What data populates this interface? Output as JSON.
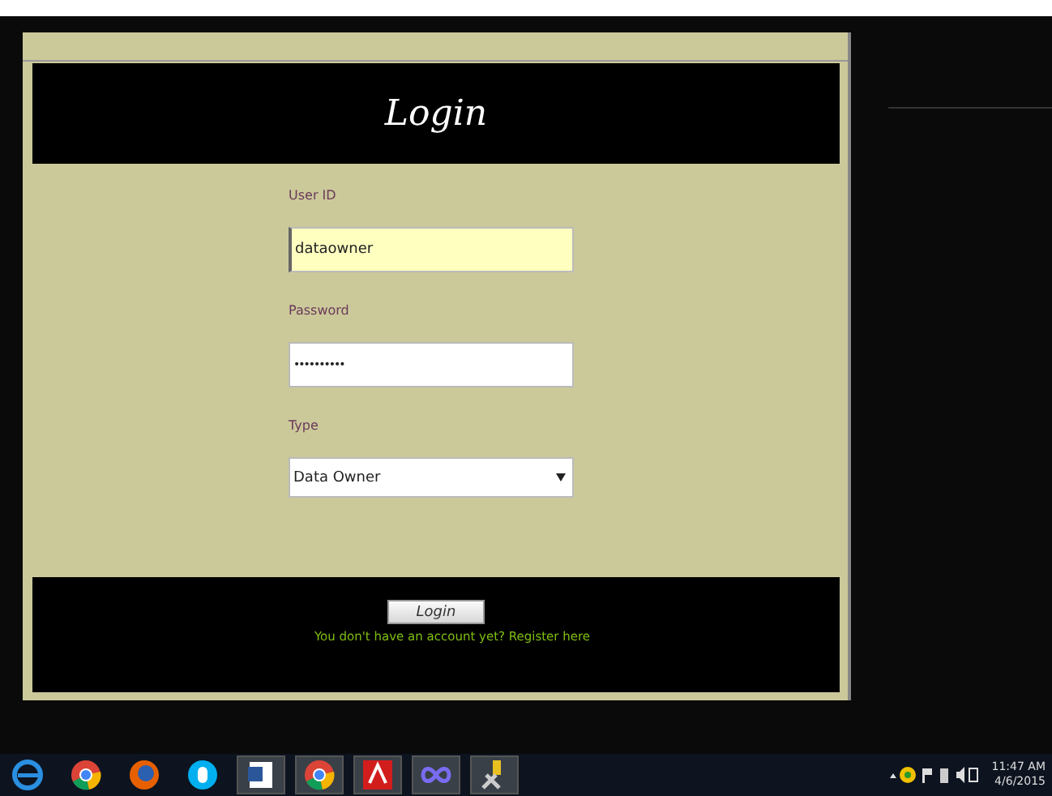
{
  "header": {
    "title": "Login"
  },
  "fields": [
    {
      "kind": "text",
      "label": "User ID",
      "value": "dataowner",
      "focused": true
    },
    {
      "kind": "password",
      "label": "Password",
      "value": "••••••••••",
      "focused": false
    },
    {
      "kind": "select",
      "label": "Type",
      "value": "Data Owner",
      "focused": false
    }
  ],
  "login_button": "Login",
  "register_link": "You don't have an account yet? Register here",
  "taskbar": {
    "apps": [
      {
        "kind": "ie",
        "pinned": false
      },
      {
        "kind": "chrome",
        "pinned": false
      },
      {
        "kind": "firefox",
        "pinned": false
      },
      {
        "kind": "skype",
        "pinned": false
      },
      {
        "kind": "word",
        "pinned": true
      },
      {
        "kind": "chrome",
        "pinned": true
      },
      {
        "kind": "pdf",
        "pinned": true
      },
      {
        "kind": "infinity",
        "pinned": true
      },
      {
        "kind": "tools",
        "pinned": true
      }
    ],
    "time": "11:47 AM",
    "date": "4/6/2015"
  }
}
